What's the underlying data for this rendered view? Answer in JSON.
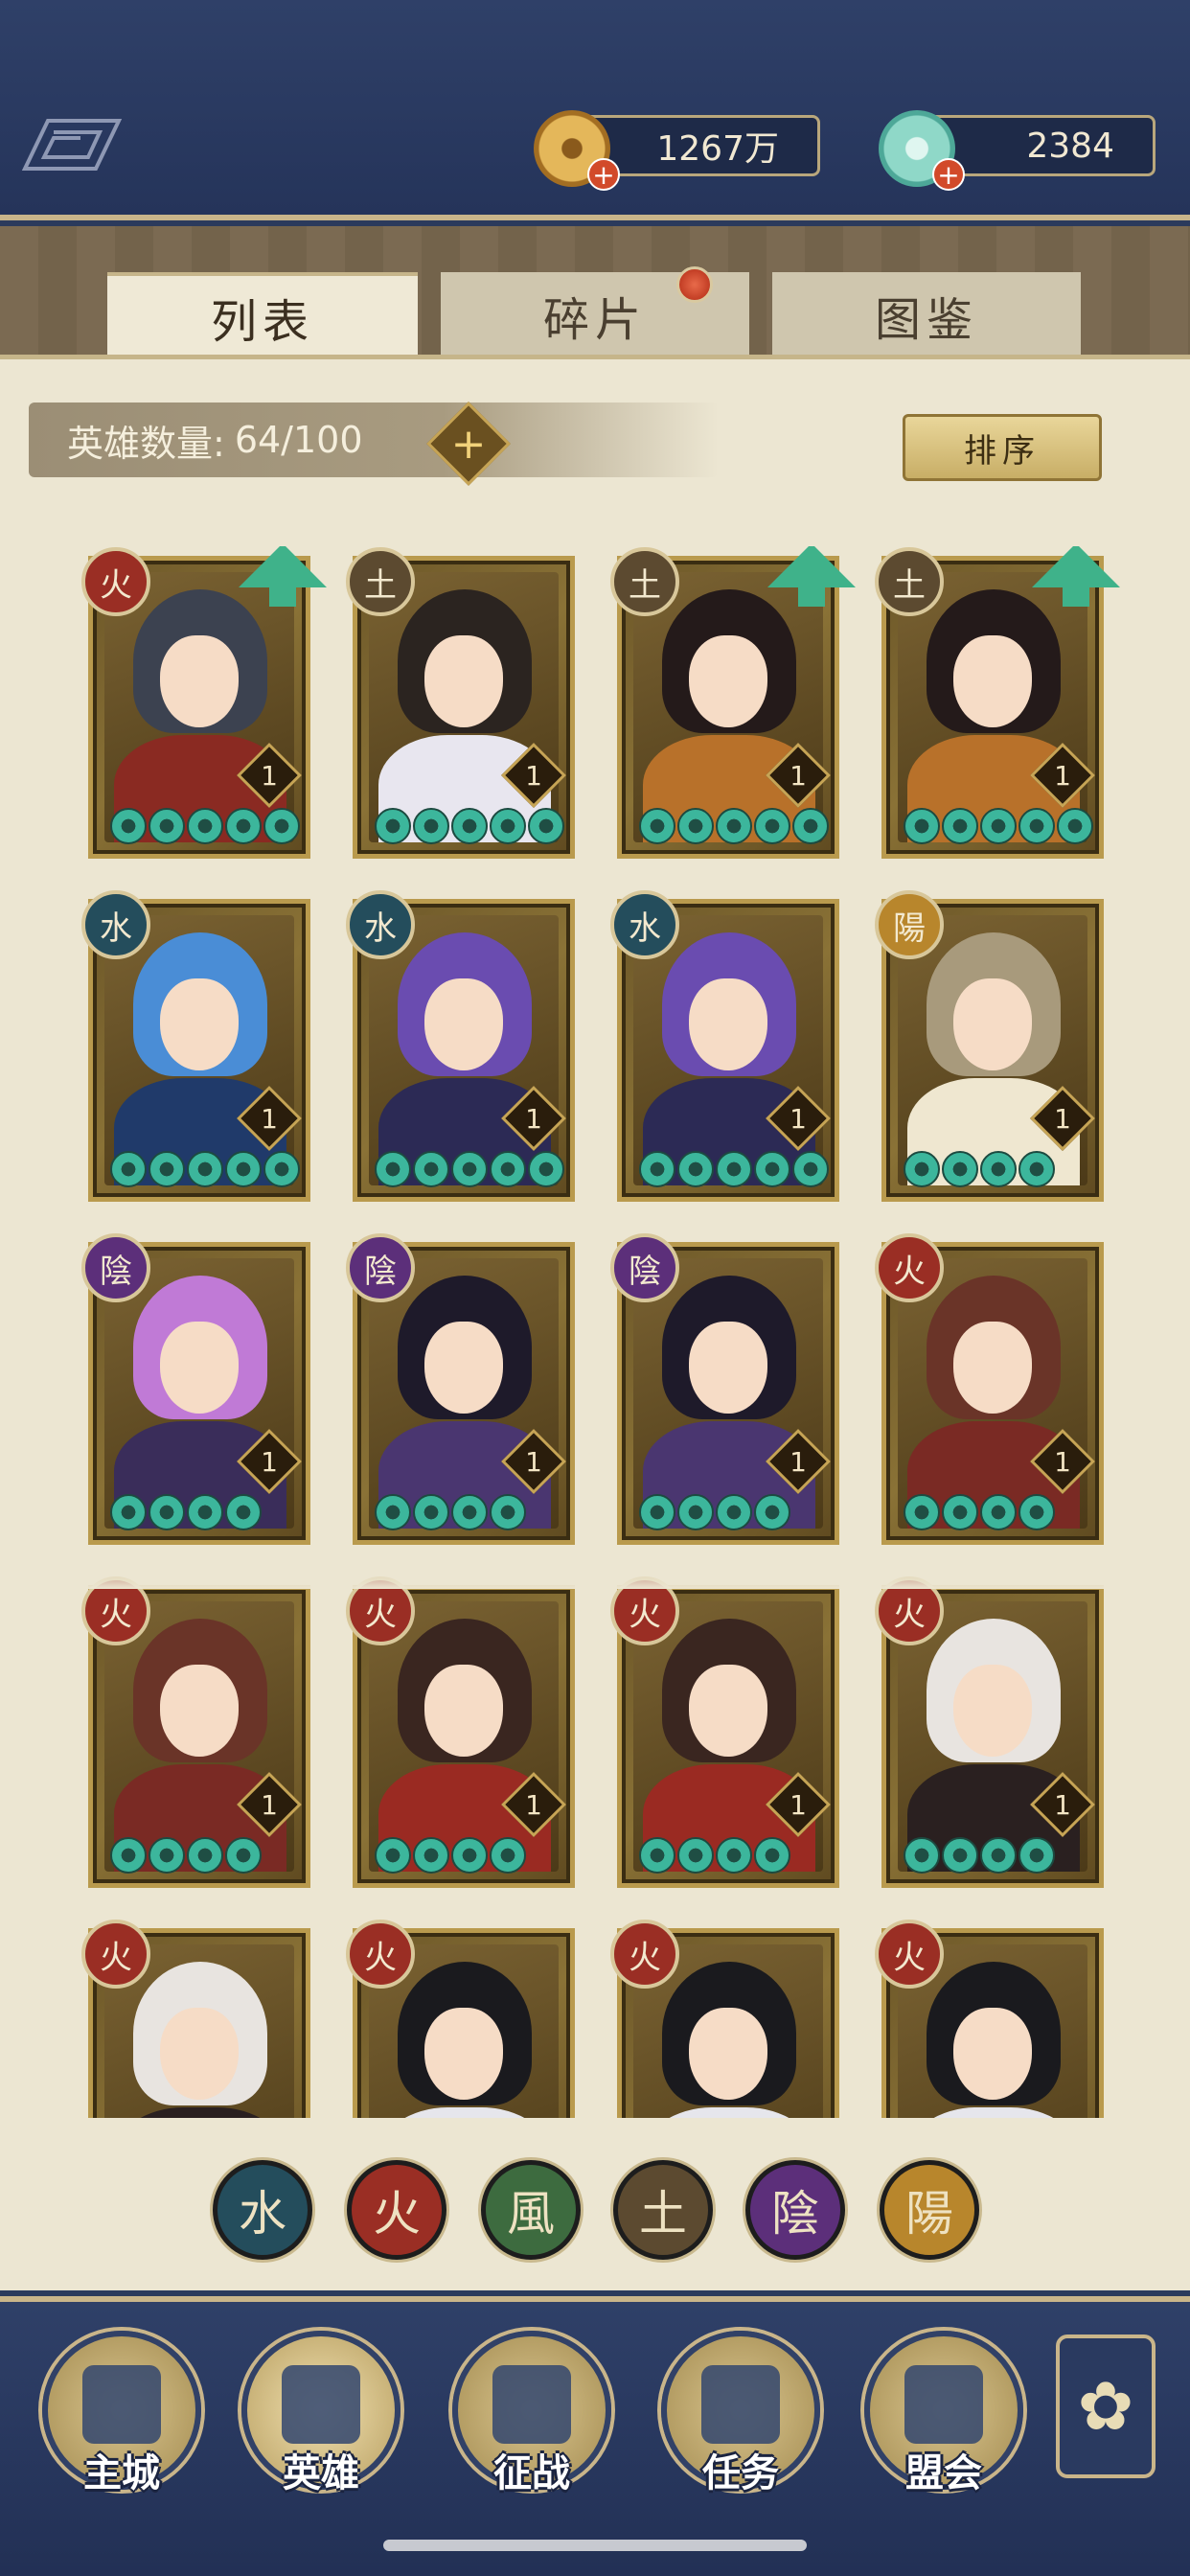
{
  "topbar": {
    "coins": "1267万",
    "jade": "2384",
    "plus": "+"
  },
  "tabs": [
    {
      "label": "列表",
      "active": true
    },
    {
      "label": "碎片",
      "active": false,
      "notify": true
    },
    {
      "label": "图鉴",
      "active": false
    }
  ],
  "hero_count": {
    "label": "英雄数量:",
    "value": "64/100",
    "plus": "+"
  },
  "sort_label": "排序",
  "element_colors": {
    "火": "#9a2e24",
    "土": "#5c4a30",
    "水": "#244d5c",
    "陰": "#5c2f7a",
    "陽": "#b8862c",
    "風": "#3d6b3f"
  },
  "heroes": [
    {
      "element": "火",
      "level": "1",
      "stars": 5,
      "upgrade": true,
      "hair": "#3c4250",
      "outfit": "#8a2a22"
    },
    {
      "element": "土",
      "level": "1",
      "stars": 5,
      "upgrade": false,
      "hair": "#2b2420",
      "outfit": "#e8e6ef"
    },
    {
      "element": "土",
      "level": "1",
      "stars": 5,
      "upgrade": true,
      "hair": "#241a1a",
      "outfit": "#b8712a"
    },
    {
      "element": "土",
      "level": "1",
      "stars": 5,
      "upgrade": true,
      "hair": "#241a1a",
      "outfit": "#b8712a"
    },
    {
      "element": "水",
      "level": "1",
      "stars": 5,
      "upgrade": false,
      "hair": "#4a8dd6",
      "outfit": "#203a6a"
    },
    {
      "element": "水",
      "level": "1",
      "stars": 5,
      "upgrade": false,
      "hair": "#6a4cb0",
      "outfit": "#2c2a55"
    },
    {
      "element": "水",
      "level": "1",
      "stars": 5,
      "upgrade": false,
      "hair": "#6a4cb0",
      "outfit": "#2c2a55"
    },
    {
      "element": "陽",
      "level": "1",
      "stars": 4,
      "upgrade": false,
      "hair": "#a89a7c",
      "outfit": "#efe7d0"
    },
    {
      "element": "陰",
      "level": "1",
      "stars": 4,
      "upgrade": false,
      "hair": "#c07ad6",
      "outfit": "#3a2d5a"
    },
    {
      "element": "陰",
      "level": "1",
      "stars": 4,
      "upgrade": false,
      "hair": "#1e1a2a",
      "outfit": "#4a3670"
    },
    {
      "element": "陰",
      "level": "1",
      "stars": 4,
      "upgrade": false,
      "hair": "#1e1a2a",
      "outfit": "#4a3670"
    },
    {
      "element": "火",
      "level": "1",
      "stars": 4,
      "upgrade": false,
      "hair": "#6a3428",
      "outfit": "#7a2a24"
    },
    {
      "element": "火",
      "level": "1",
      "stars": 4,
      "upgrade": false,
      "hair": "#6a3428",
      "outfit": "#7a2a24"
    },
    {
      "element": "火",
      "level": "1",
      "stars": 4,
      "upgrade": false,
      "hair": "#3a2620",
      "outfit": "#9a2a22"
    },
    {
      "element": "火",
      "level": "1",
      "stars": 4,
      "upgrade": false,
      "hair": "#3a2620",
      "outfit": "#9a2a22"
    },
    {
      "element": "火",
      "level": "1",
      "stars": 4,
      "upgrade": false,
      "hair": "#e8e4e0",
      "outfit": "#2a2020"
    },
    {
      "element": "火",
      "level": "",
      "stars": 0,
      "upgrade": false,
      "hair": "#e8e4e0",
      "outfit": "#2a2020"
    },
    {
      "element": "火",
      "level": "",
      "stars": 0,
      "upgrade": false,
      "hair": "#1a1a1e",
      "outfit": "#e6e6ec"
    },
    {
      "element": "火",
      "level": "",
      "stars": 0,
      "upgrade": false,
      "hair": "#1a1a1e",
      "outfit": "#e6e6ec"
    },
    {
      "element": "火",
      "level": "",
      "stars": 0,
      "upgrade": false,
      "hair": "#1a1a1e",
      "outfit": "#e6e6ec"
    }
  ],
  "filters": [
    {
      "glyph": "水",
      "color": "#244d5c"
    },
    {
      "glyph": "火",
      "color": "#9a2e24"
    },
    {
      "glyph": "風",
      "color": "#3d6b3f"
    },
    {
      "glyph": "土",
      "color": "#5c4a30"
    },
    {
      "glyph": "陰",
      "color": "#5c2f7a"
    },
    {
      "glyph": "陽",
      "color": "#b8862c"
    }
  ],
  "nav": [
    {
      "label": "主城",
      "active": false
    },
    {
      "label": "英雄",
      "active": true
    },
    {
      "label": "征战",
      "active": false
    },
    {
      "label": "任务",
      "active": false
    },
    {
      "label": "盟会",
      "active": false
    }
  ],
  "more_icon": "✿"
}
